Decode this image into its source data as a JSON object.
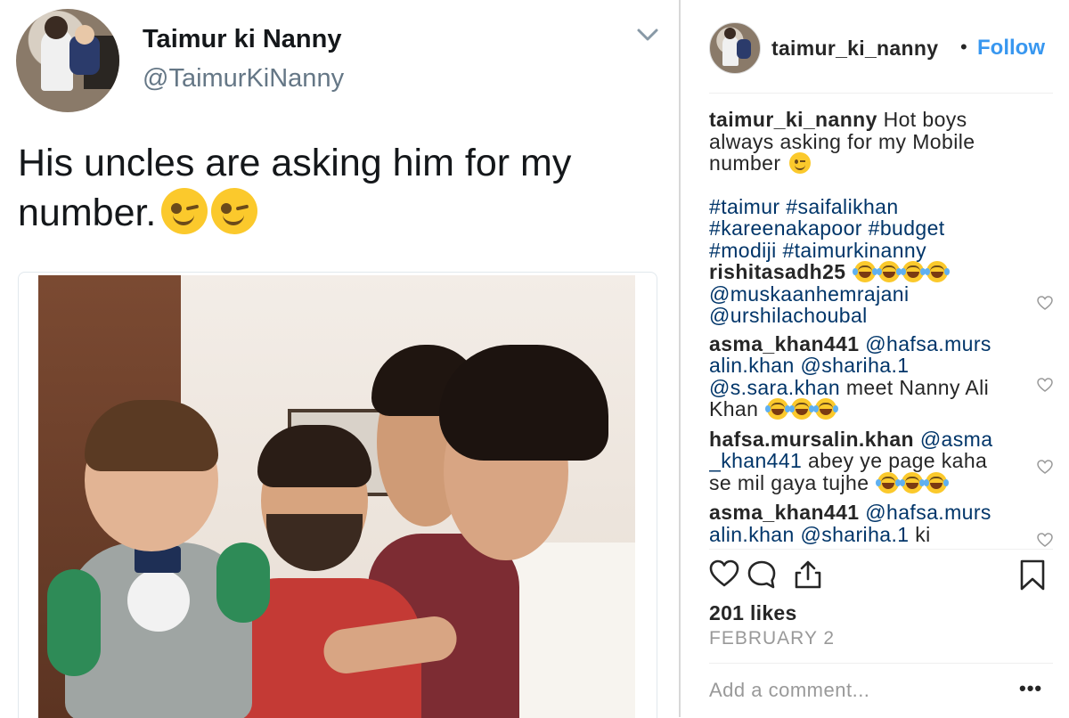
{
  "tweet": {
    "display_name": "Taimur ki Nanny",
    "handle": "@TaimurKiNanny",
    "text_line1": "His uncles are asking him for my",
    "text_line2": "number.",
    "chevron_icon": "chevron-down-icon",
    "text_emojis": [
      "winking-face",
      "winking-face"
    ]
  },
  "instagram": {
    "username": "taimur_ki_nanny",
    "separator": "•",
    "follow_label": "Follow",
    "accent_color": "#3897f0",
    "caption": {
      "user": "taimur_ki_nanny",
      "line1": "Hot boys",
      "line2": "always asking for my Mobile",
      "line3": "number",
      "hashtags_line1": "#taimur #saifalikhan",
      "hashtags_line2": "#kareenakapoor #budget",
      "hashtags_line3": "#modiji #taimurkinanny"
    },
    "comments": [
      {
        "user": "rishitasadh25",
        "mention1": "@muskaanhemrajani",
        "mention2": "@urshilachoubal",
        "emoji_count": 4
      },
      {
        "user": "asma_khan441",
        "mention1a": "@hafsa.murs",
        "mention1b": "alin.khan",
        "mention2": "@shariha.1",
        "mention3": "@s.sara.khan",
        "text1": "meet Nanny Ali",
        "text2": "Khan",
        "emoji_count": 3
      },
      {
        "user": "hafsa.mursalin.khan",
        "mention1a": "@asma",
        "mention1b": "_khan441",
        "text1": "abey ye page kaha",
        "text2": "se mil gaya tujhe",
        "emoji_count": 3
      },
      {
        "user": "asma_khan441",
        "mention1a": "@hafsa.murs",
        "mention1b": "alin.khan",
        "mention2": "@shariha.1",
        "text1": "ki"
      }
    ],
    "actions": [
      "heart-icon",
      "comment-icon",
      "share-icon",
      "bookmark-icon"
    ],
    "likes": "201 likes",
    "date": "FEBRUARY 2",
    "add_comment_placeholder": "Add a comment...",
    "more_label": "•••"
  }
}
